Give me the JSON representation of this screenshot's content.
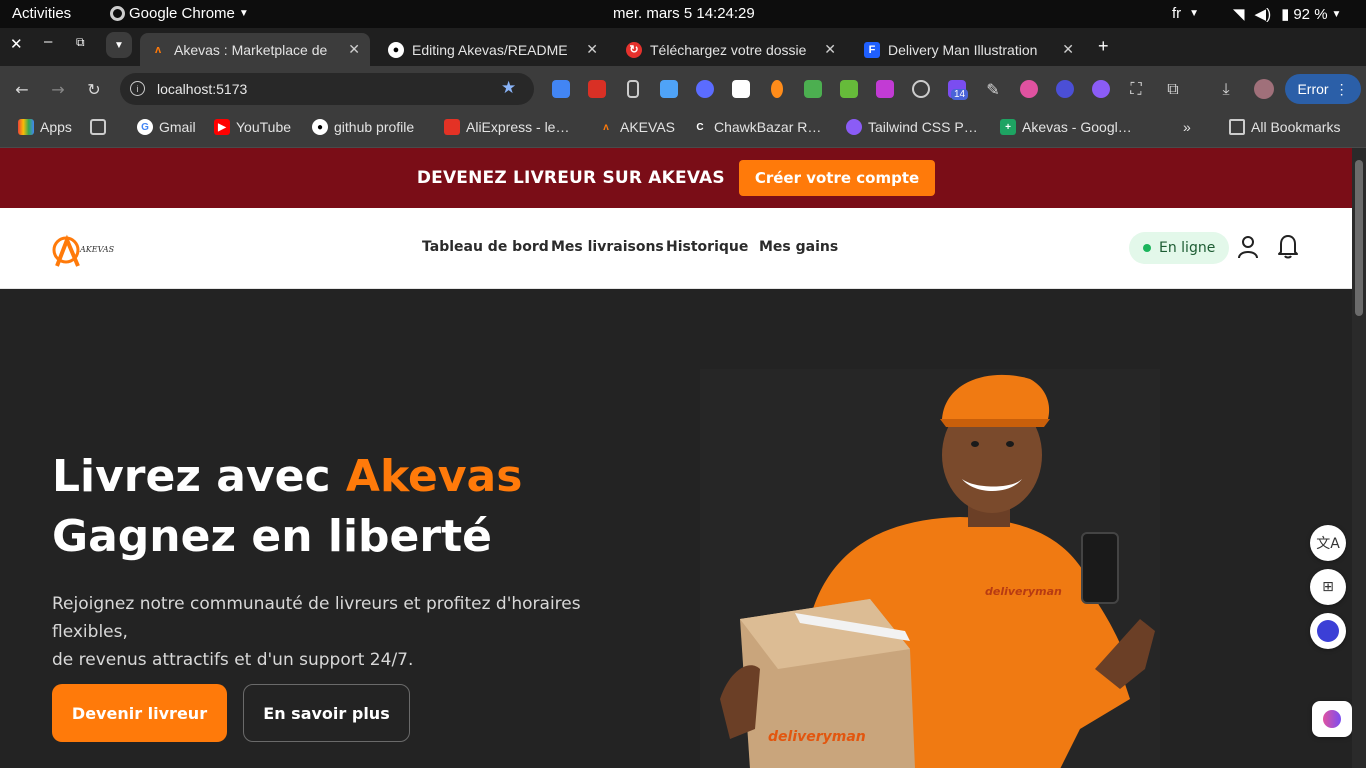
{
  "system_bar": {
    "activities": "Activities",
    "app": "Google Chrome",
    "datetime": "mer. mars 5  14:24:29",
    "lang": "fr",
    "battery": "92 %"
  },
  "tabs": [
    {
      "title": "Akevas : Marketplace de",
      "active": true
    },
    {
      "title": "Editing Akevas/README",
      "active": false
    },
    {
      "title": "Téléchargez votre dossie",
      "active": false
    },
    {
      "title": "Delivery Man Illustration",
      "active": false
    }
  ],
  "toolbar": {
    "url": "localhost:5173",
    "ext_badge": "14",
    "error_label": "Error"
  },
  "bookmarks": {
    "items": [
      "Apps",
      "Gmail",
      "YouTube",
      "github profile",
      "AliExpress - le…",
      "AKEVAS",
      "ChawkBazar R…",
      "Tailwind CSS P…",
      "Akevas - Googl…"
    ],
    "all": "All Bookmarks"
  },
  "banner": {
    "text": "DEVENEZ LIVREUR SUR AKEVAS",
    "cta": "Créer votre compte"
  },
  "nav": {
    "logo": "AKEVAS",
    "links": [
      "Tableau de bord",
      "Mes livraisons",
      "Historique",
      "Mes gains"
    ],
    "status": "En ligne"
  },
  "hero": {
    "title_part1": "Livrez avec ",
    "title_accent": "Akevas",
    "title_line2": "Gagnez en liberté",
    "subtitle_line1": "Rejoignez notre communauté de livreurs et profitez d'horaires flexibles,",
    "subtitle_line2": "de revenus attractifs et d'un support 24/7.",
    "primary_cta": "Devenir livreur",
    "secondary_cta": "En savoir plus",
    "brand_shirt": "deliveryman",
    "brand_box": "deliveryman"
  },
  "colors": {
    "accent": "#ff7a0a",
    "banner_bg": "#7a0d17",
    "status_bg": "#e3f8ea"
  }
}
